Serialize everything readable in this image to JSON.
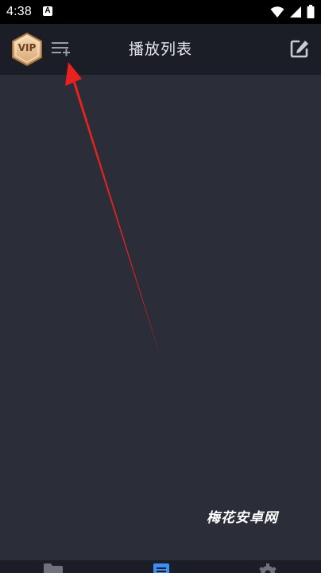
{
  "status_bar": {
    "time": "4:38",
    "notification_glyph": "A",
    "icons": [
      "wifi-icon",
      "signal-icon",
      "battery-icon"
    ]
  },
  "header": {
    "vip_label": "VIP",
    "title": "播放列表",
    "left_action_icon": "playlist-add-icon",
    "right_action_icon": "edit-icon"
  },
  "watermark": "梅花安卓网",
  "bottom_nav": {
    "items": [
      {
        "icon": "folder-icon",
        "active": false
      },
      {
        "icon": "playlist-icon",
        "active": true
      },
      {
        "icon": "settings-icon",
        "active": false
      }
    ]
  },
  "colors": {
    "background": "#2b2d38",
    "header": "#1b1d27",
    "accent": "#3d8ff5",
    "annotation": "#e8221f"
  }
}
